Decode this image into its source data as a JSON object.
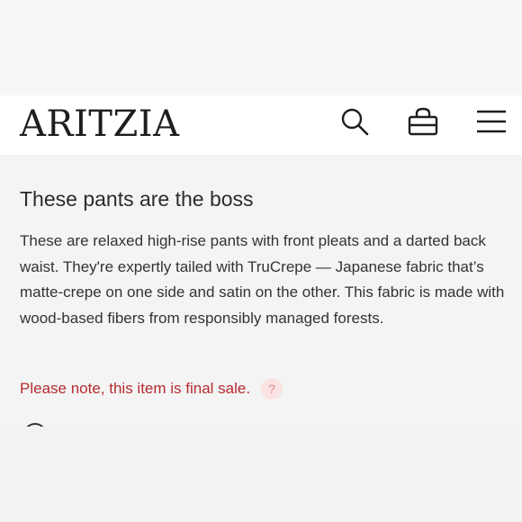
{
  "header": {
    "logo": "ARITZIA",
    "icons": {
      "search": "search-icon",
      "bag": "shopping-bag-icon",
      "menu": "hamburger-menu-icon"
    }
  },
  "product": {
    "heading": "These pants are the boss",
    "description": "These are relaxed high-rise pants with front pleats and a darted back waist. They're expertly tailed with TruCrepe — Japanese fabric that’s matte-crepe on one side and satin on the other. This fabric is made with wood-based fibers from responsibly managed forests.",
    "sale_note": "Please note, this item is final sale.",
    "help_label": "?"
  },
  "colors": {
    "sale_text": "#b52b31",
    "help_badge_bg": "#fbe3e3",
    "header_bg": "#ffffff",
    "content_bg": "#f4f4f4"
  }
}
